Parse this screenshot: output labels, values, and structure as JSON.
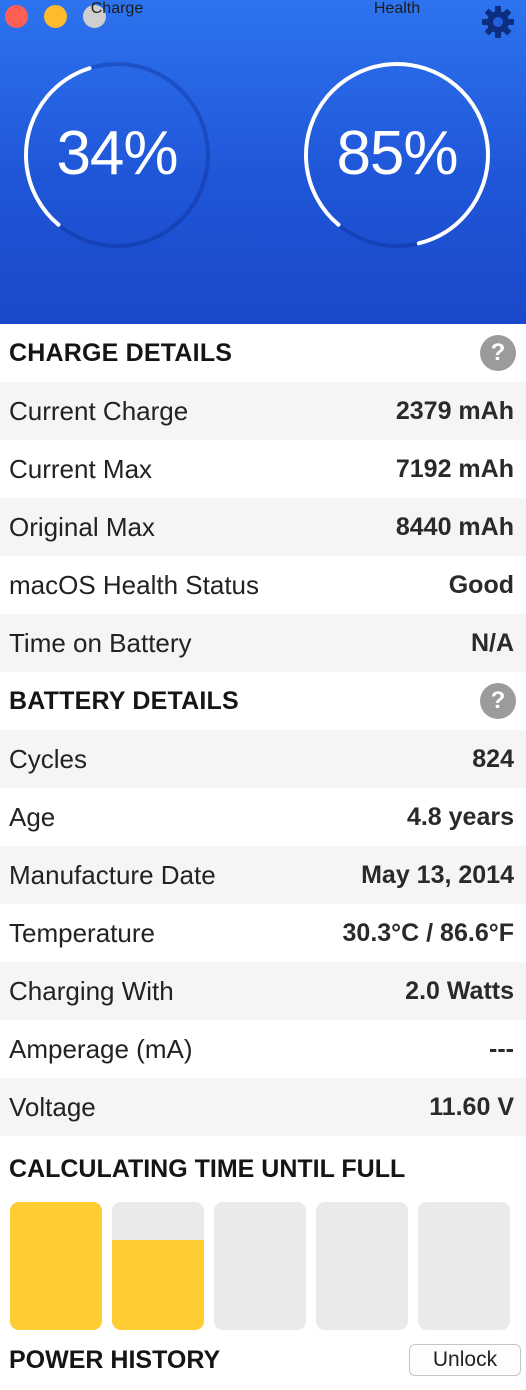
{
  "window": {
    "close_color": "#fd5f57",
    "minimize_color": "#fdbc2e",
    "zoom_color": "#cfcfcf"
  },
  "header": {
    "settings_icon": "gear-icon",
    "gradient_colors": [
      "#2d73ef",
      "#1b48c9"
    ],
    "charge": {
      "value": "34%",
      "label": "Charge",
      "fraction": 0.34
    },
    "health": {
      "value": "85%",
      "label": "Health",
      "fraction": 0.85
    }
  },
  "charge_details": {
    "title": "CHARGE DETAILS",
    "help": "?",
    "rows": [
      {
        "label": "Current Charge",
        "value": "2379 mAh"
      },
      {
        "label": "Current Max",
        "value": "7192 mAh"
      },
      {
        "label": "Original Max",
        "value": "8440 mAh"
      },
      {
        "label": "macOS Health Status",
        "value": "Good"
      },
      {
        "label": "Time on Battery",
        "value": "N/A"
      }
    ]
  },
  "battery_details": {
    "title": "BATTERY DETAILS",
    "help": "?",
    "rows": [
      {
        "label": "Cycles",
        "value": "824"
      },
      {
        "label": "Age",
        "value": "4.8 years"
      },
      {
        "label": "Manufacture Date",
        "value": "May 13, 2014"
      },
      {
        "label": "Temperature",
        "value": "30.3°C / 86.6°F"
      },
      {
        "label": "Charging With",
        "value": "2.0 Watts"
      },
      {
        "label": "Amperage (mA)",
        "value": "---"
      },
      {
        "label": "Voltage",
        "value": "11.60 V"
      }
    ]
  },
  "time_until_full": {
    "title": "CALCULATING TIME UNTIL FULL",
    "fill_color": "#ffcc33",
    "cell_fill_levels": [
      1.0,
      0.7,
      0,
      0,
      0
    ]
  },
  "power_history": {
    "title": "POWER HISTORY",
    "unlock_label": "Unlock"
  }
}
